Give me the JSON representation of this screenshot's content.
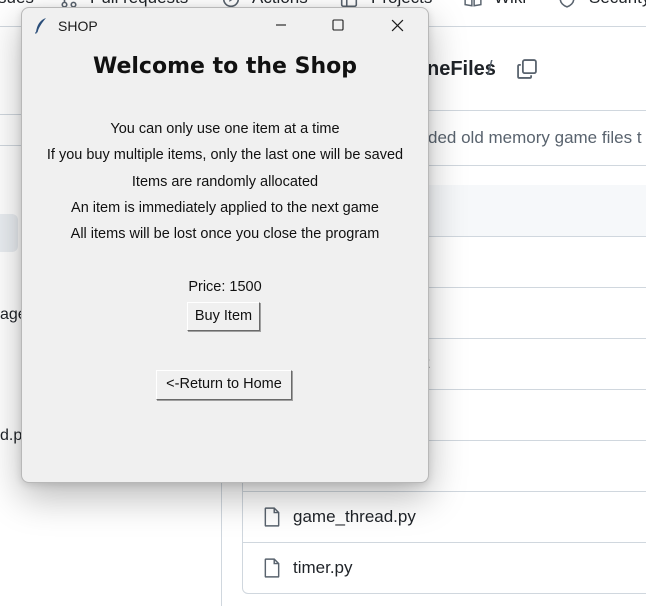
{
  "background": {
    "nav_tabs": [
      {
        "label": "sues",
        "icon": null
      },
      {
        "label": "Pull requests",
        "icon": "pull-request-icon"
      },
      {
        "label": "Actions",
        "icon": "actions-icon"
      },
      {
        "label": "Projects",
        "icon": "projects-icon"
      },
      {
        "label": "Wiki",
        "icon": "wiki-icon"
      },
      {
        "label": "Security",
        "icon": "shield-icon"
      }
    ],
    "repo_path": "neFiles",
    "repo_path_sep": "/",
    "commit_message": "ded old memory game files t",
    "left_fragments": [
      "age",
      "d.p"
    ],
    "row_fragment": "t",
    "files": [
      {
        "name": "game_thread.py",
        "icon": "file-icon"
      },
      {
        "name": "timer.py",
        "icon": "file-icon"
      }
    ]
  },
  "window": {
    "title": "SHOP",
    "icon": "feather-icon",
    "heading": "Welcome to the Shop",
    "rules": [
      "You can only use one item at a time",
      "If you buy multiple items, only the last one will be saved",
      "Items are randomly allocated",
      "An item is immediately applied to the next game",
      "All items will be lost once you close the program"
    ],
    "price": "Price: 1500",
    "buy_label": "Buy Item",
    "home_label": "<-Return to Home"
  }
}
